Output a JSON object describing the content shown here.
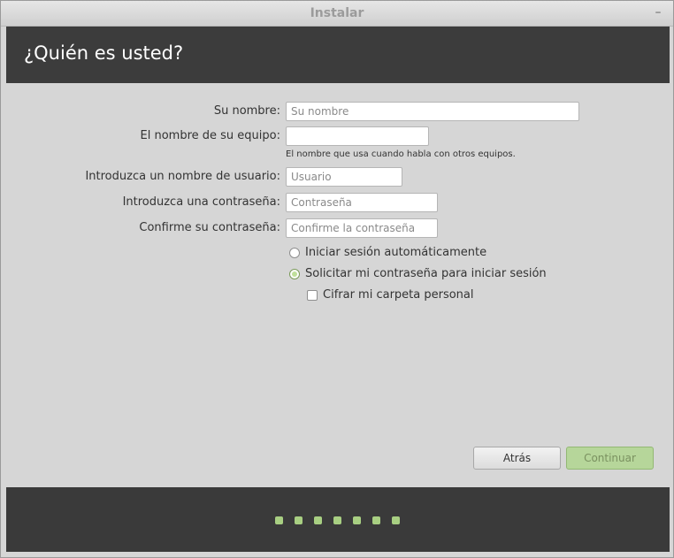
{
  "window": {
    "title": "Instalar"
  },
  "header": {
    "heading": "¿Quién es usted?"
  },
  "form": {
    "name": {
      "label": "Su nombre:",
      "placeholder": "Su nombre",
      "value": ""
    },
    "computer": {
      "label": "El nombre de su equipo:",
      "placeholder": "",
      "value": "",
      "hint": "El nombre que usa cuando habla con otros equipos."
    },
    "username": {
      "label": "Introduzca un nombre de usuario:",
      "placeholder": "Usuario",
      "value": ""
    },
    "password": {
      "label": "Introduzca una contraseña:",
      "placeholder": "Contraseña",
      "value": ""
    },
    "confirm": {
      "label": "Confirme su contraseña:",
      "placeholder": "Confirme la contraseña",
      "value": ""
    }
  },
  "login_options": {
    "auto_login": {
      "label": "Iniciar sesión automáticamente",
      "selected": false
    },
    "require_password": {
      "label": "Solicitar mi contraseña para iniciar sesión",
      "selected": true
    },
    "encrypt_home": {
      "label": "Cifrar mi carpeta personal",
      "checked": false
    }
  },
  "buttons": {
    "back": "Atrás",
    "continue": "Continuar"
  },
  "progress": {
    "steps_total": 7
  },
  "colors": {
    "accent": "#a8cf82",
    "header_bg": "#3c3c3c",
    "window_bg": "#d6d6d6"
  }
}
